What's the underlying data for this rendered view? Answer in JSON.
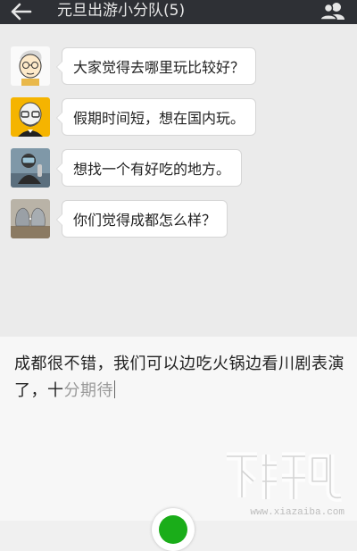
{
  "header": {
    "title": "元旦出游小分队(5)",
    "back_icon": "arrow-left-icon",
    "members_icon": "group-people-icon",
    "background": "#2e3035"
  },
  "messages": [
    {
      "avatar": "cartoon-boy-avatar",
      "text": "大家觉得去哪里玩比较好？"
    },
    {
      "avatar": "bald-man-glasses-avatar",
      "text": "假期时间短，想在国内玩。"
    },
    {
      "avatar": "diver-avatar",
      "text": "想找一个有好吃的地方。"
    },
    {
      "avatar": "album-cover-heads-avatar",
      "text": "你们觉得成都怎么样？"
    }
  ],
  "input": {
    "typed_text": "成都很不错，我们可以边吃火锅边看川剧表演了，十",
    "composing_text": "分期待"
  },
  "watermark": {
    "logo_text": "下载吧",
    "url": "www.xiazaiba.com"
  },
  "colors": {
    "accent_green": "#1aad19"
  }
}
